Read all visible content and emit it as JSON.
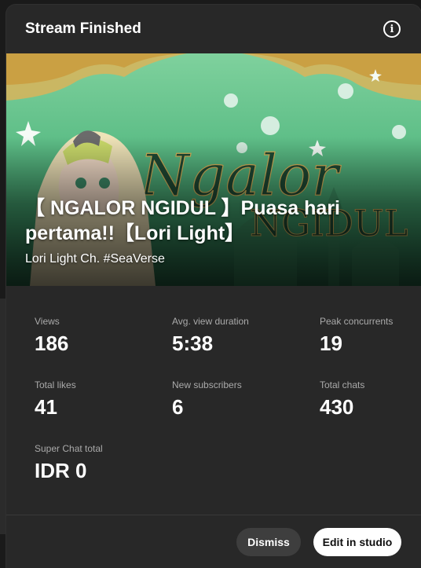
{
  "header": {
    "title": "Stream Finished",
    "info_icon": "info-icon"
  },
  "video": {
    "title": "【 NGALOR NGIDUL 】Puasa hari pertama!!【Lori Light】",
    "channel": "Lori Light Ch. #SeaVerse",
    "thumbnail_text": "Ngalor NGIDUL"
  },
  "stats": [
    {
      "label": "Views",
      "value": "186"
    },
    {
      "label": "Avg. view duration",
      "value": "5:38"
    },
    {
      "label": "Peak concurrents",
      "value": "19"
    },
    {
      "label": "Total likes",
      "value": "41"
    },
    {
      "label": "New subscribers",
      "value": "6"
    },
    {
      "label": "Total chats",
      "value": "430"
    },
    {
      "label": "Super Chat total",
      "value": "IDR 0"
    }
  ],
  "actions": {
    "dismiss_label": "Dismiss",
    "edit_label": "Edit in studio"
  },
  "colors": {
    "dialog_bg": "#282828",
    "thumbnail_green": "#5cbd86",
    "ornament_gold": "#d9b45a"
  }
}
